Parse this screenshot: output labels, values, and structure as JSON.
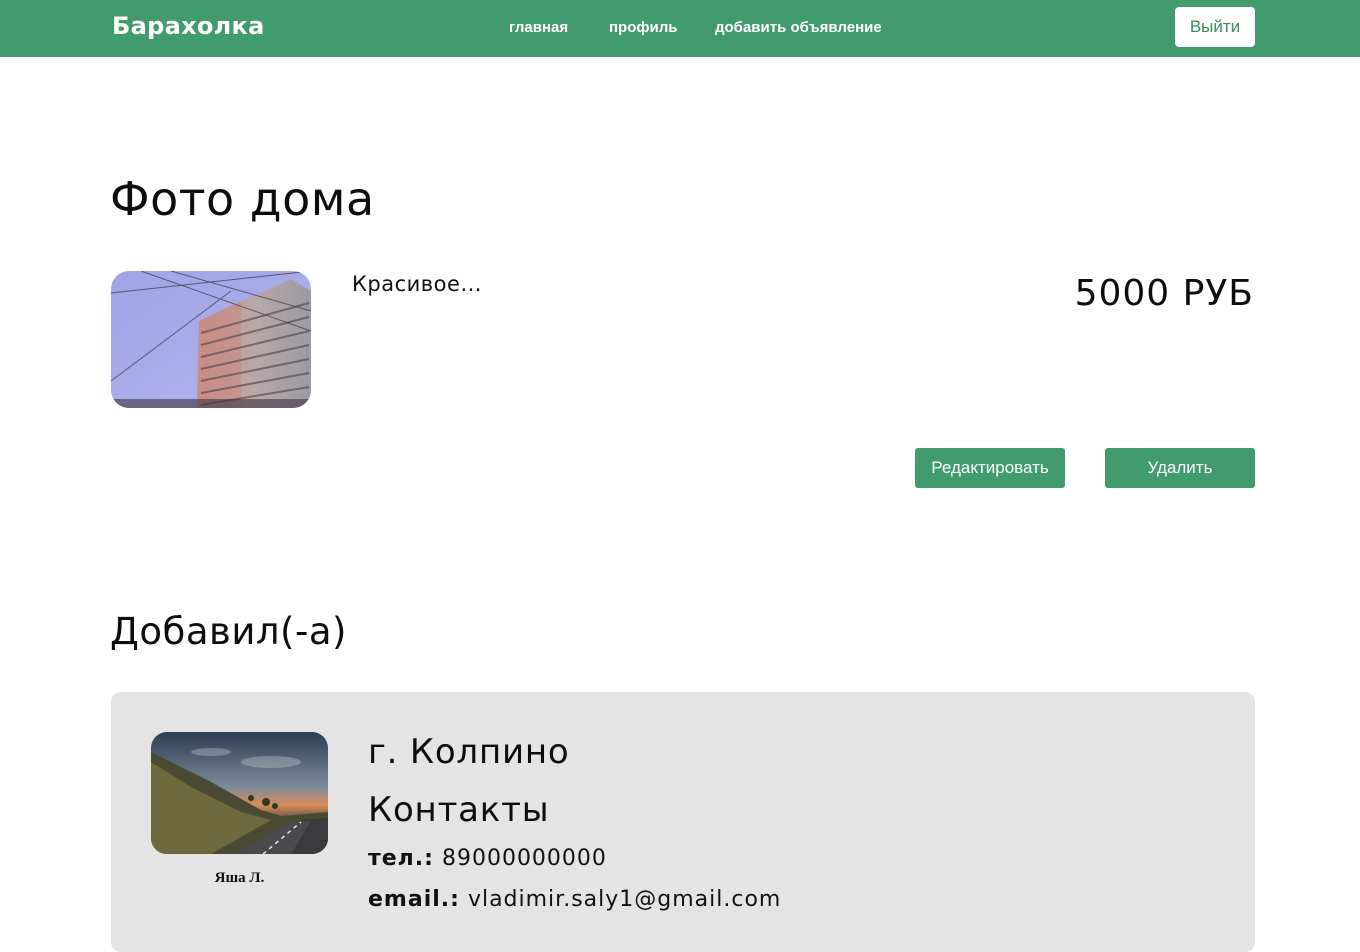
{
  "navbar": {
    "brand": "Барахолка",
    "links": {
      "home": "главная",
      "profile": "профиль",
      "add_ad": "добавить объявление"
    },
    "logout_label": "Выйти",
    "background_color": "#429b6c"
  },
  "ad": {
    "title": "Фото дома",
    "description": "Красивое...",
    "price": "5000 РУБ",
    "edit_label": "Редактировать",
    "delete_label": "Удалить"
  },
  "author": {
    "heading": "Добавил(-а)",
    "name": "Яша Л.",
    "city": "г. Колпино",
    "contacts_title": "Контакты",
    "phone_label": "тел.:",
    "phone": "89000000000",
    "email_label": "email.:",
    "email": "vladimir.saly1@gmail.com"
  }
}
